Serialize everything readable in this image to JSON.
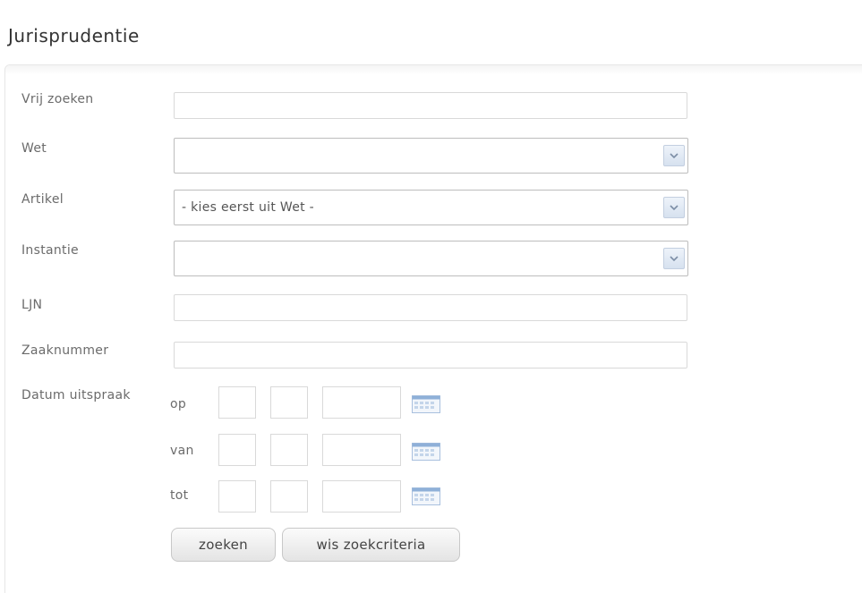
{
  "page": {
    "title": "Jurisprudentie"
  },
  "form": {
    "free_search": {
      "label": "Vrij zoeken",
      "value": "",
      "placeholder": ""
    },
    "law": {
      "label": "Wet",
      "selected": ""
    },
    "article": {
      "label": "Artikel",
      "selected": "- kies eerst uit Wet -"
    },
    "authority": {
      "label": "Instantie",
      "selected": ""
    },
    "ljn": {
      "label": "LJN",
      "value": "",
      "placeholder": ""
    },
    "case_number": {
      "label": "Zaaknummer",
      "value": "",
      "placeholder": ""
    },
    "ruling_date": {
      "label": "Datum uitspraak",
      "rows": [
        {
          "label": "op",
          "day": "",
          "month": "",
          "year": ""
        },
        {
          "label": "van",
          "day": "",
          "month": "",
          "year": ""
        },
        {
          "label": "tot",
          "day": "",
          "month": "",
          "year": ""
        }
      ]
    }
  },
  "buttons": {
    "search_label": "zoeken",
    "clear_label": "wis zoekcriteria"
  },
  "icons": {
    "dropdown": "chevron-down-icon",
    "date_picker": "calendar-icon"
  },
  "colors": {
    "field_border": "#d9d9d9",
    "dropdown_button": "#d6e1ef",
    "calendar_icon": "#8fb0d8"
  }
}
